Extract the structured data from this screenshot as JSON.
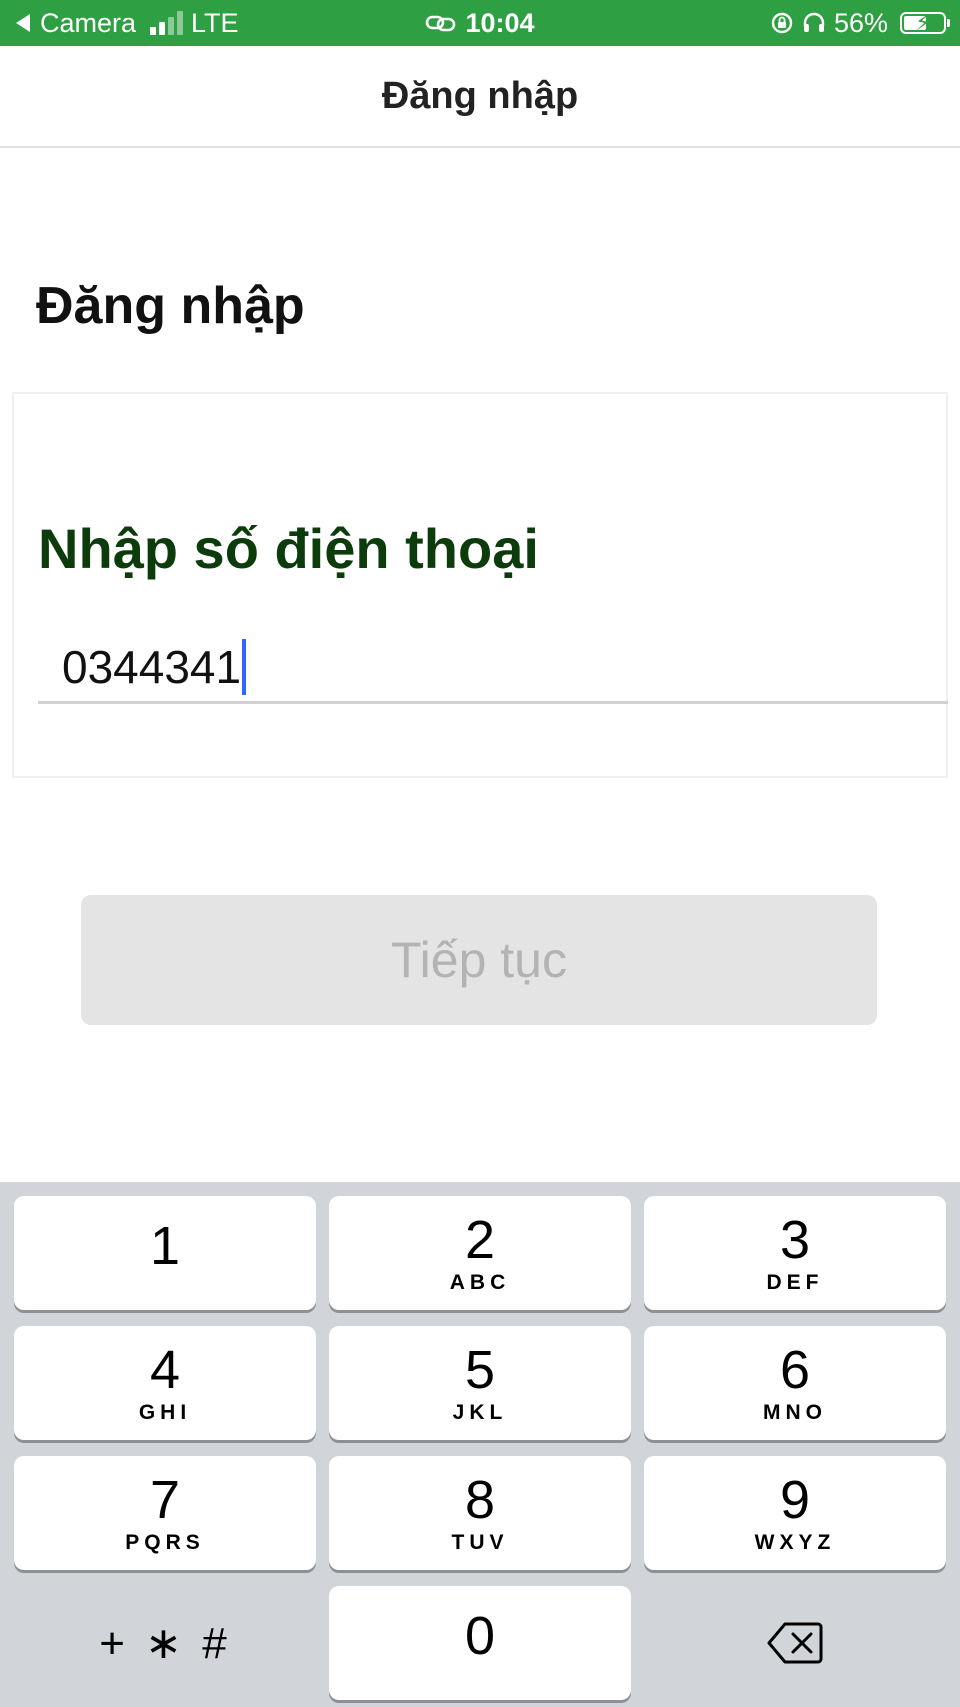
{
  "status_bar": {
    "back_label": "Camera",
    "carrier": "LTE",
    "time": "10:04",
    "battery_percent": "56%",
    "signal_bars": 2,
    "color": "#2ea043",
    "icons": [
      "back-arrow-icon",
      "signal-icon",
      "link-icon",
      "rotation-lock-icon",
      "headphones-icon",
      "battery-charging-icon"
    ]
  },
  "header": {
    "title": "Đăng nhập"
  },
  "main": {
    "heading": "Đăng nhập",
    "phone_field": {
      "label": "Nhập số điện thoại",
      "value": "0344341"
    },
    "continue_button": "Tiếp tục"
  },
  "keypad": {
    "keys": [
      {
        "digit": "1",
        "letters": ""
      },
      {
        "digit": "2",
        "letters": "ABC"
      },
      {
        "digit": "3",
        "letters": "DEF"
      },
      {
        "digit": "4",
        "letters": "GHI"
      },
      {
        "digit": "5",
        "letters": "JKL"
      },
      {
        "digit": "6",
        "letters": "MNO"
      },
      {
        "digit": "7",
        "letters": "PQRS"
      },
      {
        "digit": "8",
        "letters": "TUV"
      },
      {
        "digit": "9",
        "letters": "WXYZ"
      },
      {
        "digit": "0",
        "letters": ""
      }
    ],
    "symbols_key": "+ ∗ #",
    "delete_icon": "backspace-icon"
  },
  "colors": {
    "accent_green": "#2ea043",
    "label_green": "#0c3b0c",
    "caret_blue": "#3366ff",
    "button_disabled_bg": "#e4e4e4",
    "keypad_bg": "#d1d4d9"
  }
}
